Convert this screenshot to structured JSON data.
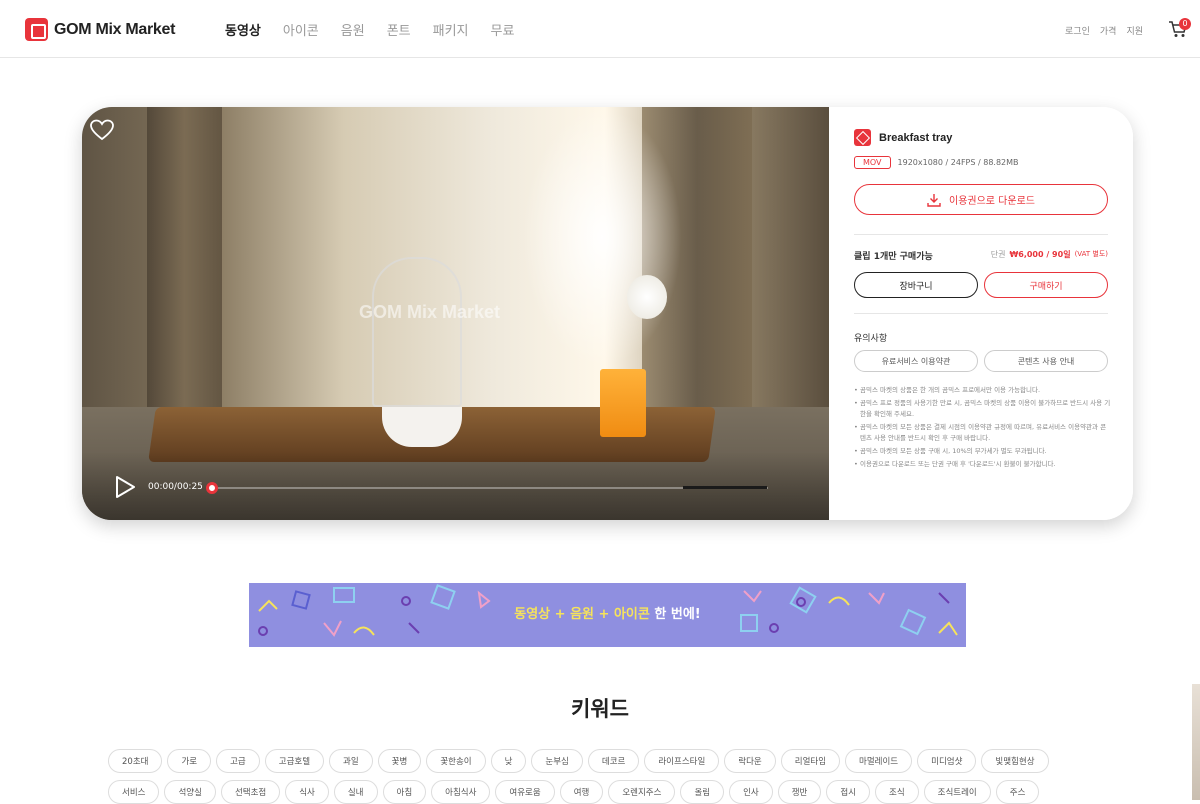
{
  "header": {
    "logo_text": "GOM Mix Market",
    "nav": [
      "동영상",
      "아이콘",
      "음원",
      "폰트",
      "패키지",
      "무료"
    ],
    "nav_active_index": 0,
    "util": [
      "로그인",
      "가격",
      "지원"
    ],
    "cart_count": "0"
  },
  "player": {
    "watermark": "GOM Mix Market",
    "time": "00:00/00:25",
    "progress": 0
  },
  "product": {
    "title": "Breakfast tray",
    "format": "MOV",
    "specs": "1920x1080 / 24FPS / 88.82MB",
    "download_label": "이용권으로 다운로드",
    "clip_label": "클립 1개만 구매가능",
    "price_prefix": "단권",
    "price": "₩6,000 / 90일",
    "vat": "(VAT 별도)",
    "cart_label": "장바구니",
    "buy_label": "구매하기",
    "notice_title": "유의사항",
    "terms_label": "유료서비스 이용약관",
    "guide_label": "콘텐츠 사용 안내",
    "notes": [
      "곰믹스 마켓의 상품은 한 개의 곰믹스 프로에서만 이용 가능합니다.",
      "곰믹스 프로 정품의 사용기한 만료 시, 곰믹스 마켓의 상품 이용이 불가하므로 반드시 사용 기한을 확인해 주세요.",
      "곰믹스 마켓의 모든 상품은 결제 시점의 이용약관 규정에 따르며, 유료서비스 이용약관과 콘텐츠 사용 안내를 반드시 확인 후 구매 바랍니다.",
      "곰믹스 마켓의 모든 상품 구매 시, 10%의 부가세가 별도 부과됩니다.",
      "이용권으로 다운로드 또는 단권 구매 후 '다운로드'시 환불이 불가합니다."
    ]
  },
  "banner": {
    "highlight": "동영상 + 음원 + 아이콘",
    "rest": " 한 번에!"
  },
  "keywords": {
    "title": "키워드",
    "tags": [
      "20초대",
      "가로",
      "고급",
      "고급호텔",
      "과일",
      "꽃병",
      "꽃한송이",
      "낮",
      "눈부심",
      "데코르",
      "라이프스타일",
      "락다운",
      "리얼타임",
      "마멀레이드",
      "미디엄샷",
      "빛맺힘현상",
      "서비스",
      "석양실",
      "선택초점",
      "식사",
      "실내",
      "아침",
      "아침식사",
      "여유로움",
      "여행",
      "오렌지주스",
      "올림",
      "인사",
      "쟁반",
      "접시",
      "조식",
      "조식트레이",
      "주스"
    ]
  },
  "colors": {
    "accent": "#e8343b",
    "banner_bg": "#8f8fe0",
    "banner_highlight": "#f6e35b"
  }
}
